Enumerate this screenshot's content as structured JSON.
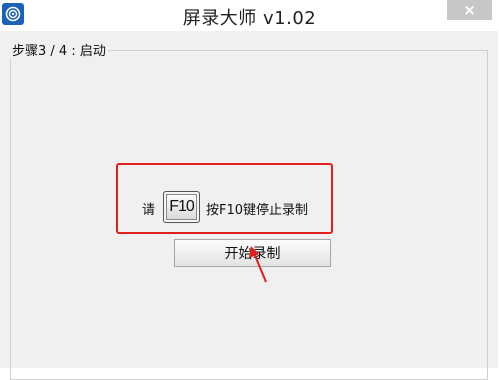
{
  "window": {
    "title": "屏录大师 v1.02",
    "close_label": "×"
  },
  "step": {
    "legend": "步骤3 / 4 : 启动"
  },
  "instruction": {
    "prefix": "请",
    "key_label": "F10",
    "suffix": "按F10键停止录制"
  },
  "start_button": {
    "label": "开始录制"
  },
  "colors": {
    "highlight": "#e01f1f",
    "app_icon": "#1a62b8"
  },
  "icons": {
    "app": "app-logo-icon",
    "close": "close-icon",
    "annotation": "red-arrow-icon"
  }
}
